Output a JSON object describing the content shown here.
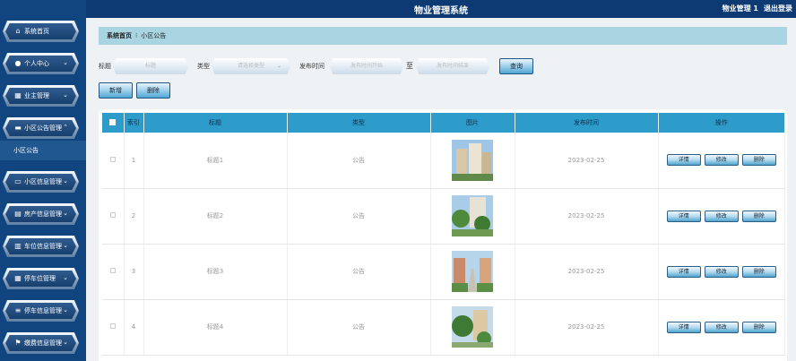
{
  "header": {
    "title": "物业管理系统",
    "user": "物业管理 1",
    "logout": "退出登录"
  },
  "sidebar": {
    "items": [
      {
        "label": "系统首页",
        "icon": "home-icon",
        "glyph": "⌂",
        "chevron": ""
      },
      {
        "label": "个人中心",
        "icon": "user-icon",
        "glyph": "●",
        "chevron": "⌄"
      },
      {
        "label": "业主管理",
        "icon": "grid-icon",
        "glyph": "▦",
        "chevron": "⌄"
      },
      {
        "label": "小区公告管理",
        "icon": "folder-icon",
        "glyph": "▬",
        "chevron": "⌃"
      },
      {
        "label": "小区信息管理",
        "icon": "monitor-icon",
        "glyph": "▭",
        "chevron": "⌄"
      },
      {
        "label": "房产信息管理",
        "icon": "clipboard-icon",
        "glyph": "▤",
        "chevron": "⌄"
      },
      {
        "label": "车位信息管理",
        "icon": "document-icon",
        "glyph": "▥",
        "chevron": "⌄"
      },
      {
        "label": "停车位管理",
        "icon": "grid-icon",
        "glyph": "▦",
        "chevron": "⌄"
      },
      {
        "label": "停车信息管理",
        "icon": "list-icon",
        "glyph": "≡",
        "chevron": "⌄"
      },
      {
        "label": "缴费信息管理",
        "icon": "flag-icon",
        "glyph": "⚑",
        "chevron": "⌄"
      }
    ],
    "submenu_label": "小区公告"
  },
  "breadcrumb": {
    "home": "系统首页",
    "sep": "⁝",
    "current": "小区公告"
  },
  "search": {
    "title_label": "标题",
    "title_placeholder": "标题",
    "type_label": "类型",
    "type_placeholder": "请选择类型",
    "time_label": "发布时间",
    "start_placeholder": "发布时间开始",
    "to_label": "至",
    "end_placeholder": "发布时间结束",
    "query_label": "查询"
  },
  "actions": {
    "add_label": "新增",
    "delete_label": "删除"
  },
  "table": {
    "headers": [
      "",
      "索引",
      "标题",
      "类型",
      "图片",
      "发布时间",
      "操作"
    ],
    "rows": [
      {
        "index": "1",
        "title": "标题1",
        "type": "公告",
        "date": "2023-02-25"
      },
      {
        "index": "2",
        "title": "标题2",
        "type": "公告",
        "date": "2023-02-25"
      },
      {
        "index": "3",
        "title": "标题3",
        "type": "公告",
        "date": "2023-02-25"
      },
      {
        "index": "4",
        "title": "标题4",
        "type": "公告",
        "date": "2023-02-25"
      }
    ],
    "row_actions": {
      "detail": "详情",
      "edit": "修改",
      "delete": "删除"
    }
  },
  "colors": {
    "topbar": "#0d3a73",
    "sidebar": "#10457f",
    "table_header": "#2d9ccb",
    "breadcrumb": "#a9d4e2"
  }
}
